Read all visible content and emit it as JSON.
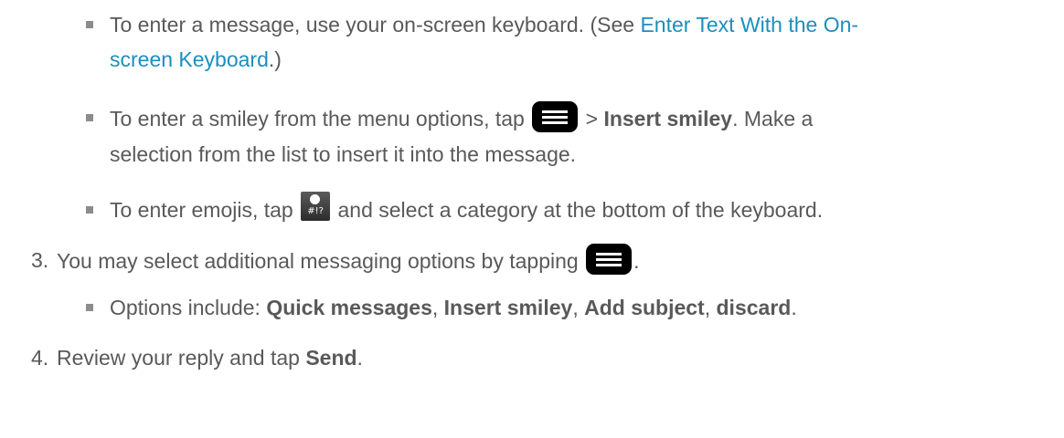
{
  "list": {
    "sub_items_a": [
      {
        "before": "To enter a message, use your on-screen keyboard. (See ",
        "link_part1": "Enter Text With the On-",
        "link_part2": "screen Keyboard",
        "after": ".)"
      },
      {
        "before": "To enter a smiley from the menu options, tap",
        "sep": " > ",
        "bold": "Insert smiley",
        "after1": ". Make a",
        "line2": "selection from the list to insert it into the message."
      },
      {
        "before": "To enter emojis, tap",
        "after": " and select a category at the bottom of the keyboard."
      }
    ],
    "step3": {
      "number": "3.",
      "text": "You may select additional messaging options by tapping",
      "end": ".",
      "sub": {
        "prefix": "Options include: ",
        "opt1": "Quick messages",
        "opt2": "Insert smiley",
        "opt3": "Add subject",
        "opt4": "discard",
        "comma": ", ",
        "end": "."
      }
    },
    "step4": {
      "number": "4.",
      "text": "Review your reply and tap ",
      "bold": "Send",
      "end": "."
    }
  },
  "icons": {
    "menu": "menu-icon",
    "emoji": "emoji-keyboard-icon",
    "emoji_symbols": "#!?"
  }
}
